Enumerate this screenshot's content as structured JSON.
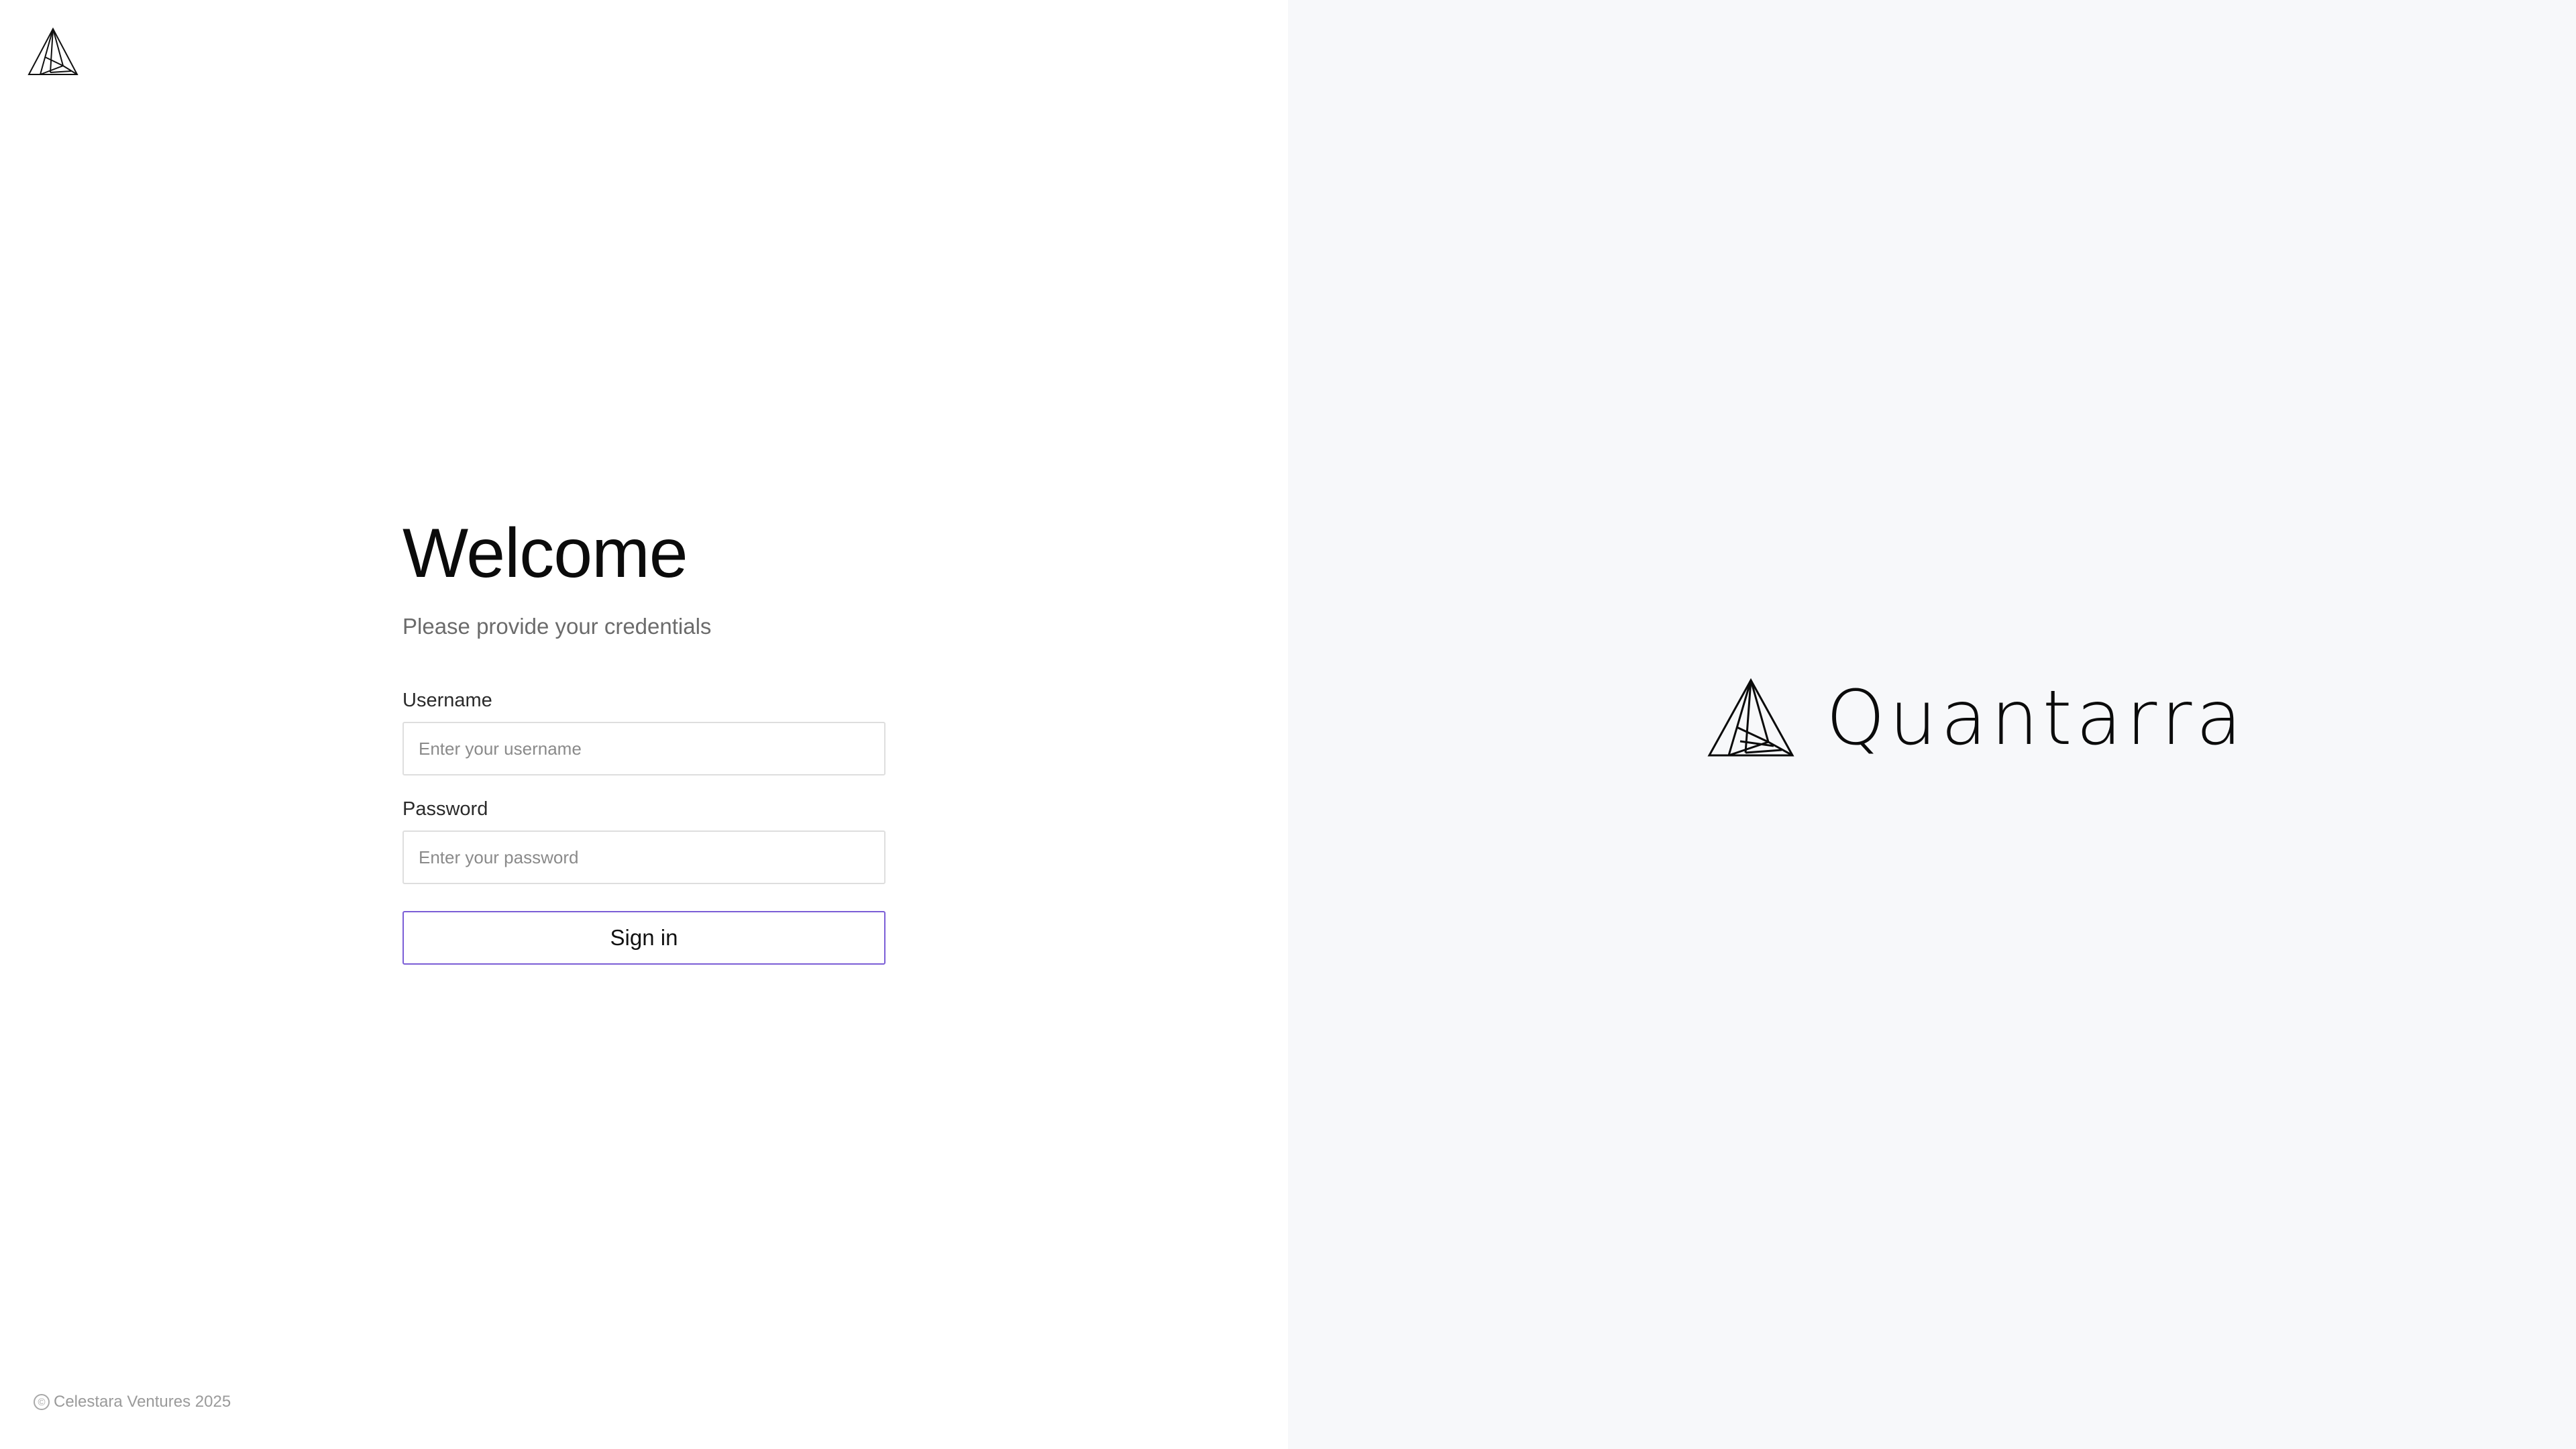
{
  "login": {
    "title": "Welcome",
    "subtitle": "Please provide your credentials",
    "username_label": "Username",
    "username_placeholder": "Enter your username",
    "username_value": "",
    "password_label": "Password",
    "password_placeholder": "Enter your password",
    "password_value": "",
    "signin_label": "Sign in"
  },
  "footer": {
    "copyright_symbol": "©",
    "text": "Celestara Ventures 2025"
  },
  "brand": {
    "name": "Quantarra",
    "icon": "triangle-logo-icon"
  },
  "colors": {
    "accent": "#7b5ed6",
    "right_panel_bg": "#f7f8fa"
  }
}
